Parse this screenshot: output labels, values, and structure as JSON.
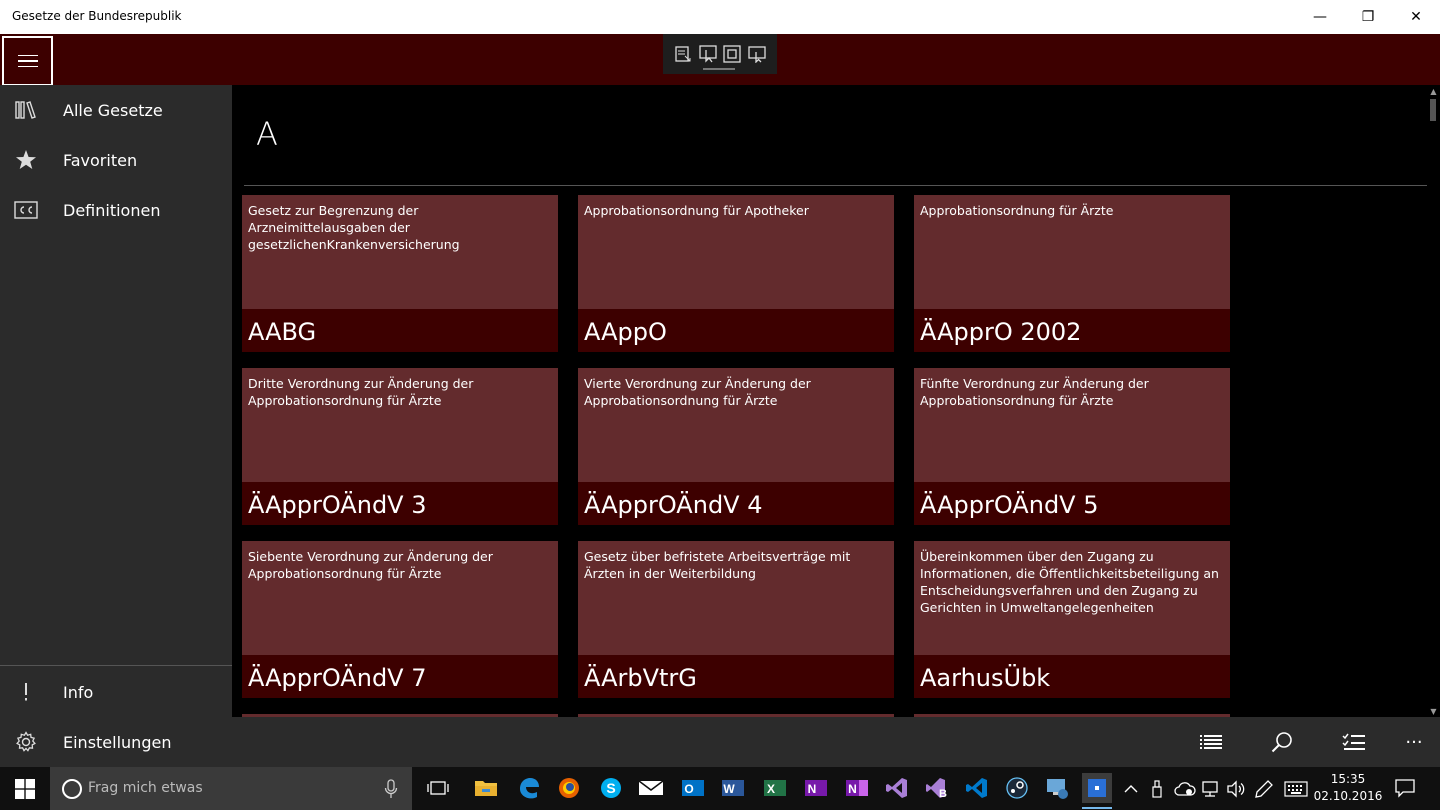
{
  "window": {
    "title": "Gesetze der Bundesrepublik",
    "minimize_glyph": "—",
    "restore_glyph": "❐",
    "close_glyph": "✕"
  },
  "sidebar": {
    "top_items": [
      {
        "label": "Alle Gesetze",
        "icon": "library-icon"
      },
      {
        "label": "Favoriten",
        "icon": "star-icon"
      },
      {
        "label": "Definitionen",
        "icon": "closed-caption-icon"
      }
    ],
    "bottom_items": [
      {
        "label": "Info",
        "icon": "exclamation-icon"
      },
      {
        "label": "Einstellungen",
        "icon": "gear-icon"
      }
    ]
  },
  "main": {
    "section_letter": "A",
    "tiles": [
      {
        "description": "Gesetz zur Begrenzung der Arzneimittelausgaben der gesetzlichenKrankenversicherung",
        "abbr": "AABG"
      },
      {
        "description": "Approbationsordnung für Apotheker",
        "abbr": "AAppO"
      },
      {
        "description": "Approbationsordnung für Ärzte",
        "abbr": "ÄApprO 2002"
      },
      {
        "description": "Dritte Verordnung zur Änderung der Approbationsordnung für Ärzte",
        "abbr": "ÄApprOÄndV 3"
      },
      {
        "description": "Vierte Verordnung zur Änderung der Approbationsordnung für Ärzte",
        "abbr": "ÄApprOÄndV 4"
      },
      {
        "description": "Fünfte Verordnung zur Änderung der Approbationsordnung für Ärzte",
        "abbr": "ÄApprOÄndV 5"
      },
      {
        "description": "Siebente Verordnung zur Änderung der Approbationsordnung für Ärzte",
        "abbr": "ÄApprOÄndV 7"
      },
      {
        "description": "Gesetz über befristete Arbeitsverträge mit Ärzten in der Weiterbildung",
        "abbr": "ÄArbVtrG"
      },
      {
        "description": "Übereinkommen über den Zugang zu Informationen, die Öffentlichkeitsbeteiligung an Entscheidungsverfahren und den Zugang zu Gerichten in Umweltangelegenheiten",
        "abbr": "AarhusÜbk"
      }
    ]
  },
  "commandbar": {
    "more_glyph": "···"
  },
  "taskbar": {
    "search_placeholder": "Frag mich etwas",
    "time": "15:35",
    "date": "02.10.2016",
    "apps": [
      "task-view-icon",
      "file-explorer-icon",
      "edge-icon",
      "firefox-icon",
      "skype-icon",
      "mail-icon",
      "outlook-icon",
      "word-icon",
      "excel-icon",
      "onenote-icon",
      "onenote-2016-icon",
      "visual-studio-icon",
      "visual-studio-blend-icon",
      "vscode-icon",
      "steam-icon",
      "remote-desktop-icon",
      "gesetze-app-icon"
    ],
    "app_letters": {
      "outlook": "O",
      "word": "W",
      "excel": "X",
      "onenote": "N",
      "onenote2016": "N",
      "blend": "B"
    },
    "colors": {
      "outlook": "#0072c6",
      "word": "#2b579a",
      "excel": "#217346",
      "onenote": "#7719aa",
      "vs": "#68217a",
      "vscode": "#007acc",
      "active_app": "#2a6fd6"
    }
  },
  "colors": {
    "accent_dark": "#3d0000",
    "tile_bg": "#632b2d",
    "sidebar_bg": "#2b2b2b"
  }
}
